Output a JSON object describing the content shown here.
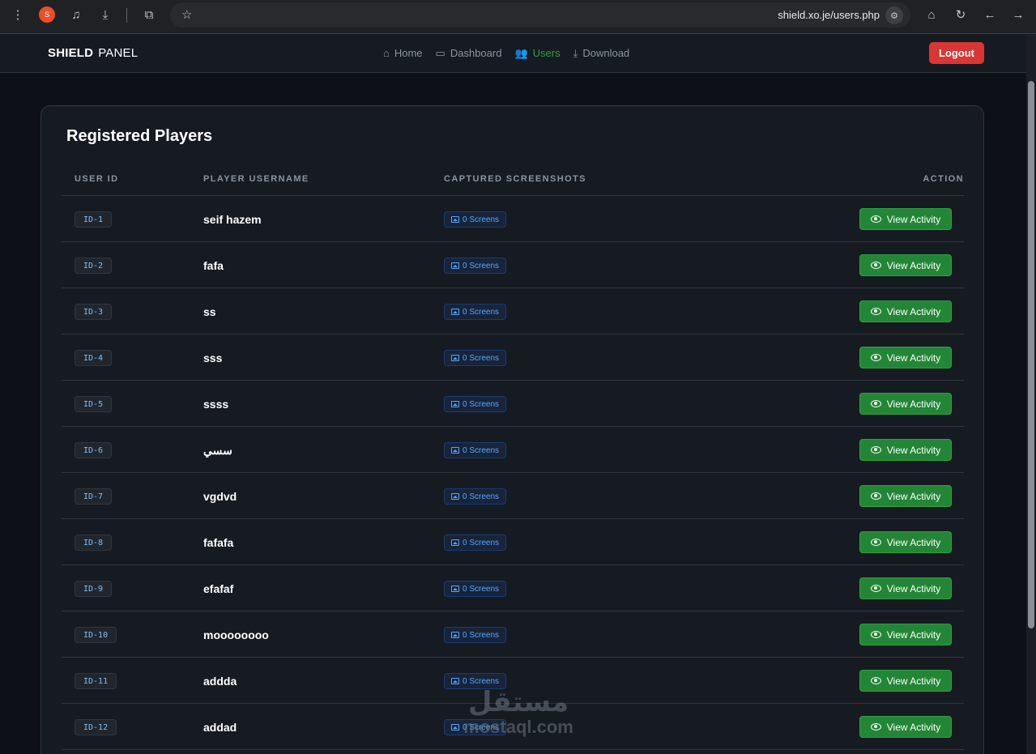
{
  "browser": {
    "profile_initial": "S",
    "url": "shield.xo.je/users.php",
    "icons": [
      "menu-dots-icon",
      "profile-avatar",
      "media-controls-icon",
      "download-icon",
      "extensions-icon",
      "star-icon",
      "site-settings-icon",
      "home-icon",
      "reload-icon",
      "back-icon",
      "forward-icon"
    ]
  },
  "nav": {
    "brand_bold": "SHIELD",
    "brand_light": "PANEL",
    "links": [
      {
        "label": "Home",
        "icon": "home-icon",
        "active": false
      },
      {
        "label": "Dashboard",
        "icon": "monitor-icon",
        "active": false
      },
      {
        "label": "Users",
        "icon": "users-icon",
        "active": true
      },
      {
        "label": "Download",
        "icon": "download-icon",
        "active": false
      }
    ],
    "logout_label": "Logout"
  },
  "card": {
    "title": "Registered Players",
    "columns": [
      "USER ID",
      "PLAYER USERNAME",
      "CAPTURED SCREENSHOTS",
      "ACTION"
    ],
    "rows": [
      {
        "id": "ID-1",
        "username": "seif hazem",
        "screens": "0 Screens",
        "action": "View Activity"
      },
      {
        "id": "ID-2",
        "username": "fafa",
        "screens": "0 Screens",
        "action": "View Activity"
      },
      {
        "id": "ID-3",
        "username": "ss",
        "screens": "0 Screens",
        "action": "View Activity"
      },
      {
        "id": "ID-4",
        "username": "sss",
        "screens": "0 Screens",
        "action": "View Activity"
      },
      {
        "id": "ID-5",
        "username": "ssss",
        "screens": "0 Screens",
        "action": "View Activity"
      },
      {
        "id": "ID-6",
        "username": "سسي",
        "screens": "0 Screens",
        "action": "View Activity"
      },
      {
        "id": "ID-7",
        "username": "vgdvd",
        "screens": "0 Screens",
        "action": "View Activity"
      },
      {
        "id": "ID-8",
        "username": "fafafa",
        "screens": "0 Screens",
        "action": "View Activity"
      },
      {
        "id": "ID-9",
        "username": "efafaf",
        "screens": "0 Screens",
        "action": "View Activity"
      },
      {
        "id": "ID-10",
        "username": "moooooooo",
        "screens": "0 Screens",
        "action": "View Activity"
      },
      {
        "id": "ID-11",
        "username": "addda",
        "screens": "0 Screens",
        "action": "View Activity"
      },
      {
        "id": "ID-12",
        "username": "addad",
        "screens": "0 Screens",
        "action": "View Activity"
      }
    ]
  },
  "watermark": {
    "arabic": "مستقل",
    "latin": "mostaql.com"
  },
  "colors": {
    "background": "#0d1117",
    "surface": "#161b22",
    "accent_green": "#238636",
    "danger": "#da3633",
    "link_active": "#2ea043",
    "id_text": "#79c0ff"
  }
}
